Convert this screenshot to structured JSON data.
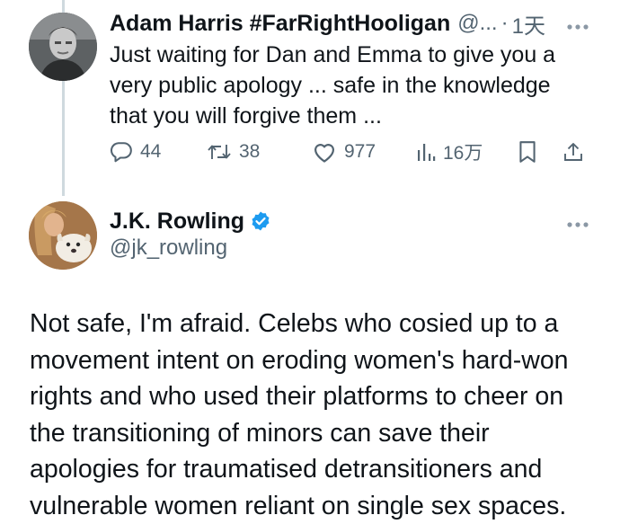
{
  "tweets": [
    {
      "author_name": "Adam Harris #FarRightHooligan",
      "handle": "@...",
      "separator": "·",
      "time": "1天",
      "text_lines": [
        "Just waiting for Dan and Emma to give you a",
        "very public apology ... safe in the knowledge",
        "that you will forgive them ..."
      ],
      "actions": {
        "replies": "44",
        "retweets": "38",
        "likes": "977",
        "views": "16万"
      }
    },
    {
      "author_name": "J.K. Rowling",
      "handle": "@jk_rowling",
      "verified": true,
      "text_lines": [
        "Not safe, I'm afraid. Celebs who cosied up to a",
        "movement intent on eroding women's hard-won",
        "rights and who used their platforms to cheer on",
        "the transitioning of minors can save their",
        "apologies for traumatised detransitioners and",
        "vulnerable women reliant on single sex spaces."
      ]
    }
  ],
  "colors": {
    "text": "#0f1419",
    "secondary": "#536471",
    "thread_line": "#cfd9de",
    "verified": "#1d9bf0"
  },
  "icons": [
    "more-icon",
    "reply-icon",
    "retweet-icon",
    "like-icon",
    "views-icon",
    "bookmark-icon",
    "share-icon",
    "verified-badge-icon"
  ]
}
